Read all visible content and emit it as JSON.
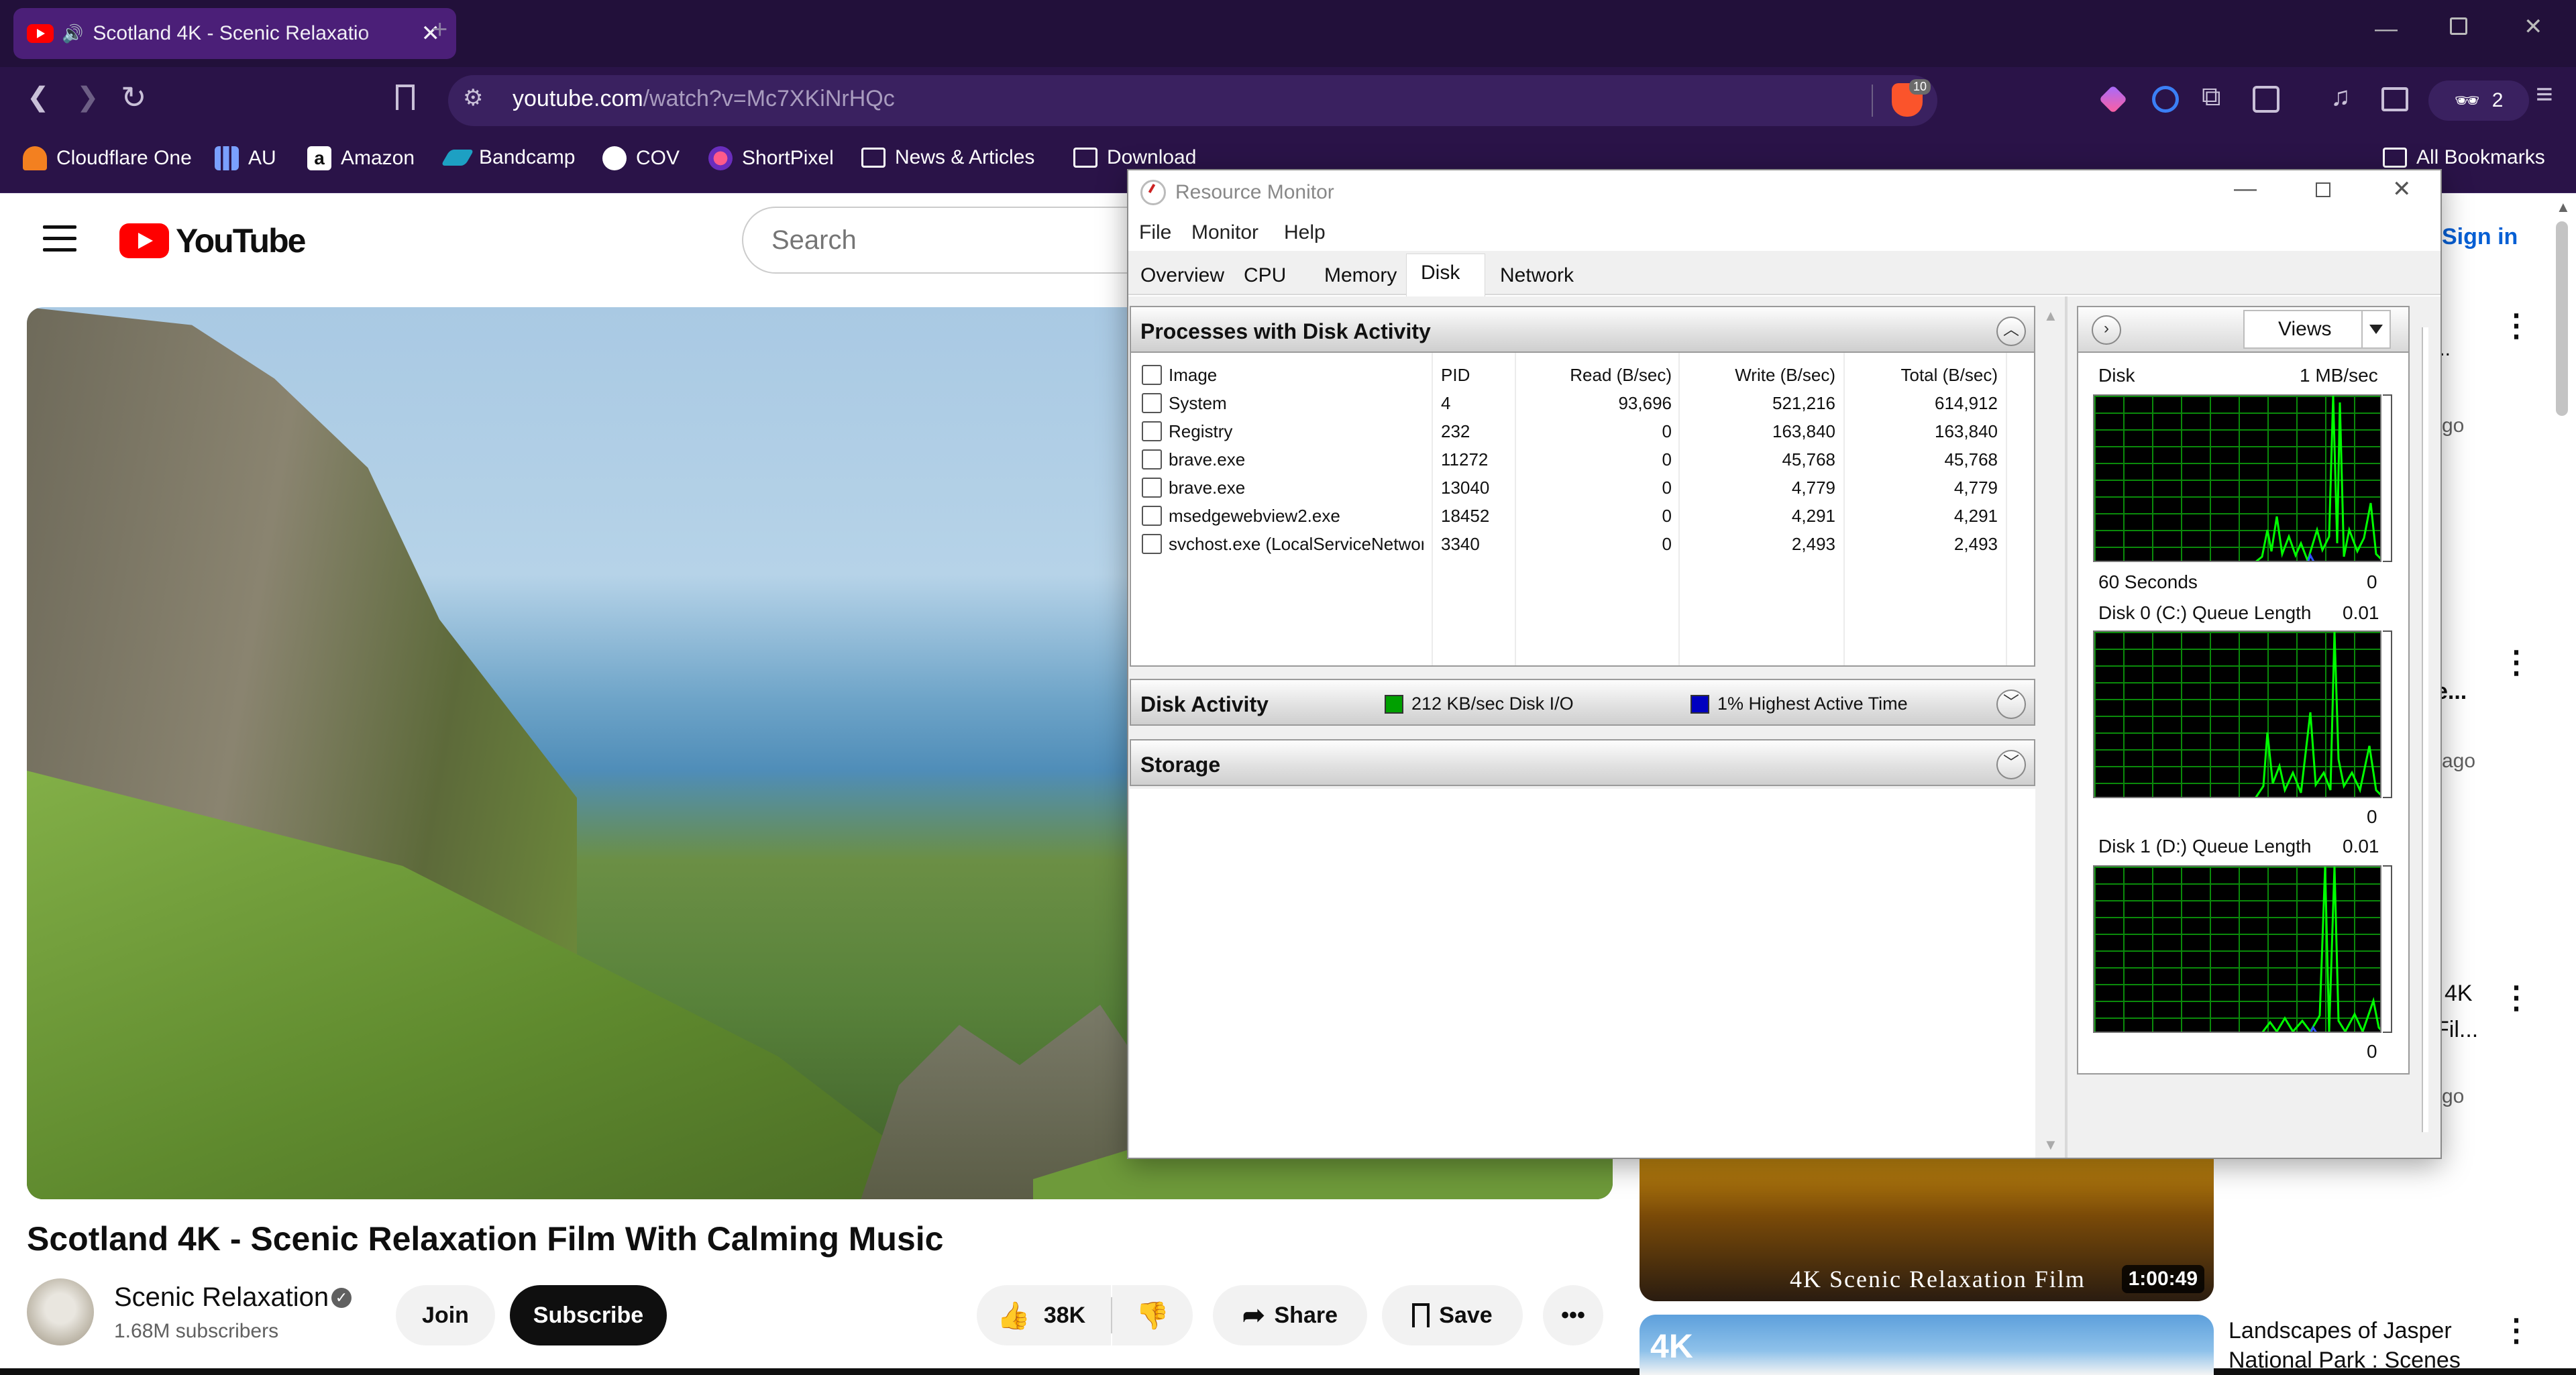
{
  "browser": {
    "tab_title": "Scotland 4K - Scenic Relaxatio",
    "url_host": "youtube.com",
    "url_path": "/watch?v=Mc7XKiNrHQc",
    "brave_badge": "10",
    "profile_count": "2",
    "new_tab": "+",
    "bookmarks": [
      "Cloudflare One",
      "AU",
      "Amazon",
      "Bandcamp",
      "COV",
      "ShortPixel",
      "News & Articles",
      "Download"
    ],
    "all_bookmarks": "All Bookmarks"
  },
  "youtube": {
    "logo_text": "YouTube",
    "search_placeholder": "Search",
    "sign_in": "Sign in",
    "video_title": "Scotland 4K - Scenic Relaxation Film With Calming Music",
    "channel_name": "Scenic Relaxation",
    "subscribers": "1.68M subscribers",
    "join": "Join",
    "subscribe": "Subscribe",
    "likes": "38K",
    "share": "Share",
    "save": "Save",
    "sidebar": {
      "frag1": "...",
      "ago1": "go",
      "frag2": "e...",
      "ago2": "ago",
      "frag3a": "4K",
      "frag3b": "Fil...",
      "ago3": "go",
      "thumb1_label": "4K Scenic Relaxation Film",
      "thumb1_duration": "1:00:49",
      "thumb2_badge": "4K",
      "video2_title": "Landscapes of Jasper National Park : Scenes"
    }
  },
  "resource_monitor": {
    "title": "Resource Monitor",
    "menu": [
      "File",
      "Monitor",
      "Help"
    ],
    "tabs": [
      "Overview",
      "CPU",
      "Memory",
      "Disk",
      "Network"
    ],
    "processes_header": "Processes with Disk Activity",
    "columns": [
      "Image",
      "PID",
      "Read (B/sec)",
      "Write (B/sec)",
      "Total (B/sec)"
    ],
    "rows": [
      [
        "System",
        "4",
        "93,696",
        "521,216",
        "614,912"
      ],
      [
        "Registry",
        "232",
        "0",
        "163,840",
        "163,840"
      ],
      [
        "brave.exe",
        "11272",
        "0",
        "45,768",
        "45,768"
      ],
      [
        "brave.exe",
        "13040",
        "0",
        "4,779",
        "4,779"
      ],
      [
        "msedgewebview2.exe",
        "18452",
        "0",
        "4,291",
        "4,291"
      ],
      [
        "svchost.exe (LocalServiceNetwor...",
        "3340",
        "0",
        "2,493",
        "2,493"
      ]
    ],
    "disk_activity": {
      "label": "Disk Activity",
      "io": "212 KB/sec Disk I/O",
      "active": "1% Highest Active Time",
      "io_color": "#00a000",
      "active_color": "#0000c0"
    },
    "storage_label": "Storage",
    "views_label": "Views",
    "graphs": [
      {
        "title": "Disk",
        "max": "1 MB/sec",
        "footer_left": "60 Seconds",
        "footer_right": "0"
      },
      {
        "title": "Disk 0 (C:) Queue Length",
        "max": "0.01",
        "footer_left": "",
        "footer_right": "0"
      },
      {
        "title": "Disk 1 (D:) Queue Length",
        "max": "0.01",
        "footer_left": "",
        "footer_right": "0"
      }
    ]
  }
}
